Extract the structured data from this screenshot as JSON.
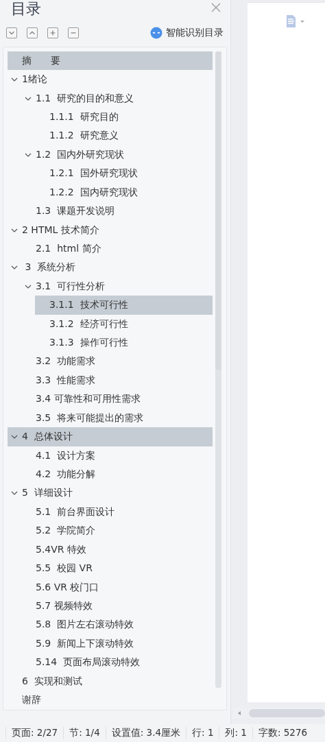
{
  "panel": {
    "title": "目录",
    "tools": [
      {
        "kind": "down"
      },
      {
        "kind": "up"
      },
      {
        "kind": "plus"
      },
      {
        "kind": "minus"
      }
    ],
    "smart_button": "智能识别目录"
  },
  "toc": [
    {
      "label": "摘　　要",
      "selected": true
    },
    {
      "label": "1绪论",
      "selected": false,
      "expanded": true,
      "children": [
        {
          "label": "1.1  研究的目的和意义",
          "selected": false,
          "expanded": true,
          "children": [
            {
              "label": "1.1.1  研究目的",
              "selected": false
            },
            {
              "label": "1.1.2  研究意义",
              "selected": false
            }
          ]
        },
        {
          "label": "1.2  国内外研究现状",
          "selected": false,
          "expanded": true,
          "children": [
            {
              "label": "1.2.1  国外研究现状",
              "selected": false
            },
            {
              "label": "1.2.2  国内研究现状",
              "selected": false
            }
          ]
        },
        {
          "label": "1.3  课题开发说明",
          "selected": false
        }
      ]
    },
    {
      "label": "2 HTML 技术简介",
      "selected": false,
      "expanded": true,
      "children": [
        {
          "label": "2.1  html 简介",
          "selected": false
        }
      ]
    },
    {
      "label": " 3  系统分析",
      "selected": false,
      "expanded": true,
      "children": [
        {
          "label": "3.1  可行性分析",
          "selected": false,
          "expanded": true,
          "children": [
            {
              "label": "3.1.1  技术可行性",
              "selected": true
            },
            {
              "label": "3.1.2  经济可行性",
              "selected": false
            },
            {
              "label": "3.1.3  操作可行性",
              "selected": false
            }
          ]
        },
        {
          "label": "3.2  功能需求",
          "selected": false
        },
        {
          "label": "3.3  性能需求",
          "selected": false
        },
        {
          "label": "3.4 可靠性和可用性需求",
          "selected": false
        },
        {
          "label": "3.5  将来可能提出的需求",
          "selected": false
        }
      ]
    },
    {
      "label": "4  总体设计",
      "selected": true,
      "expanded": true,
      "children": [
        {
          "label": "4.1  设计方案",
          "selected": false
        },
        {
          "label": "4.2  功能分解",
          "selected": false
        }
      ]
    },
    {
      "label": "5  详细设计",
      "selected": false,
      "expanded": true,
      "children": [
        {
          "label": "5.1  前台界面设计",
          "selected": false
        },
        {
          "label": "5.2  学院简介",
          "selected": false
        },
        {
          "label": "5.4VR 特效",
          "selected": false
        },
        {
          "label": "5.5  校园 VR",
          "selected": false
        },
        {
          "label": "5.6 VR 校门口",
          "selected": false
        },
        {
          "label": "5.7 视频特效",
          "selected": false
        },
        {
          "label": "5.8  图片左右滚动特效",
          "selected": false
        },
        {
          "label": "5.9  新闻上下滚动特效",
          "selected": false
        },
        {
          "label": "5.14  页面布局滚动特效",
          "selected": false
        }
      ]
    },
    {
      "label": "6  实现和测试",
      "selected": false
    },
    {
      "label": "谢辞",
      "selected": false
    }
  ],
  "status_bar": [
    "页面: 2/27",
    "节: 1/4",
    "设置值: 3.4厘米",
    "行: 1",
    "列: 1",
    "字数: 5276"
  ]
}
